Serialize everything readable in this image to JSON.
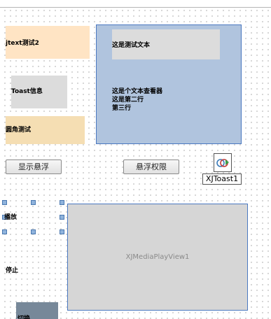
{
  "labels": {
    "jtext": "jtext测试2",
    "toast": "Toast信息",
    "round": "圆角测试",
    "play": "播放",
    "stop": "停止",
    "bottom_clipped": "切换"
  },
  "panel": {
    "inner_label": "这是测试文本",
    "text_lines": [
      "这是个文本查看器",
      "这是第二行",
      "第三行"
    ]
  },
  "buttons": {
    "show_float": "显示悬浮",
    "float_permission": "悬浮权限"
  },
  "component": {
    "name": "XJToast1"
  },
  "media": {
    "name": "XJMediaPlayView1"
  },
  "colors": {
    "jtext_bg": "#ffe4c4",
    "toast_bg": "#dcdcdc",
    "round_bg": "#f5deb3",
    "panel_bg": "#b0c4de",
    "panel_inner_bg": "#dcdcdc",
    "media_bg": "#d6d6d6",
    "bottom_bg": "#778899"
  }
}
